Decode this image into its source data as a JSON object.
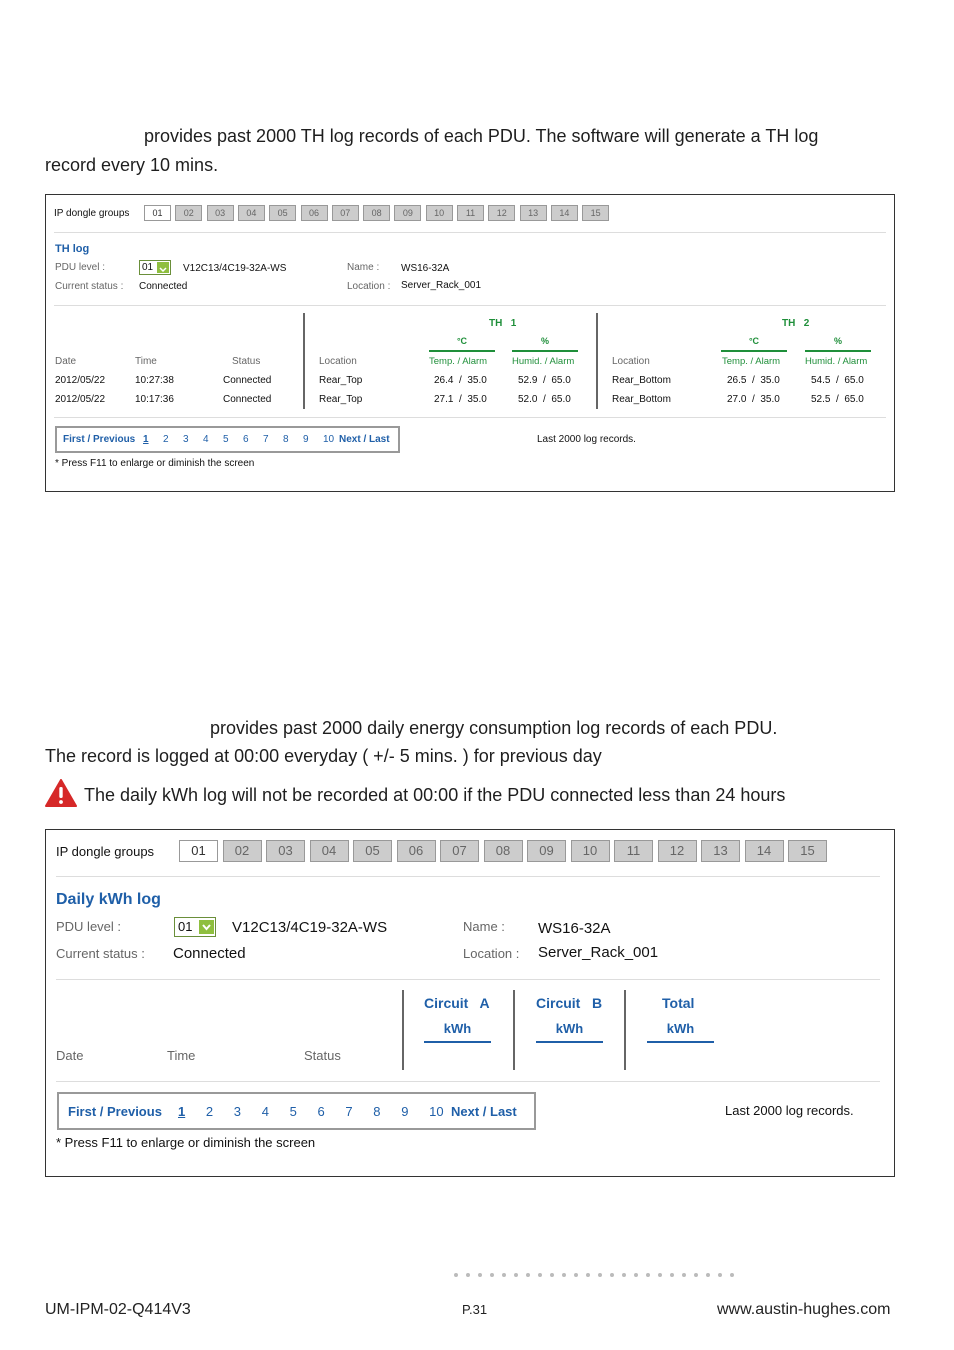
{
  "intro_th": {
    "line1": "provides past 2000 TH log records of each PDU.  The software will generate a TH log",
    "line2": "record every 10 mins."
  },
  "th_panel": {
    "group_label": "IP dongle groups",
    "groups": [
      "01",
      "02",
      "03",
      "04",
      "05",
      "06",
      "07",
      "08",
      "09",
      "10",
      "11",
      "12",
      "13",
      "14",
      "15"
    ],
    "title": "TH log",
    "pdu_level_label": "PDU level :",
    "pdu_level_value": "01",
    "pdu_model": "V12C13/4C19-32A-WS",
    "name_label": "Name :",
    "name_value": "WS16-32A",
    "status_label": "Current status :",
    "status_value": "Connected",
    "location_label": "Location :",
    "location_value": "Server_Rack_001",
    "th1_title": "TH",
    "th1_num": "1",
    "th2_title": "TH",
    "th2_num": "2",
    "unit_c": "°C",
    "unit_pct": "%",
    "col_date": "Date",
    "col_time": "Time",
    "col_status": "Status",
    "col_location": "Location",
    "col_temp": "Temp. / Alarm",
    "col_humid": "Humid. / Alarm",
    "rows": [
      {
        "date": "2012/05/22",
        "time": "10:27:38",
        "status": "Connected",
        "loc1": "Rear_Top",
        "t1": "26.4  /  35.0",
        "h1": "52.9  /  65.0",
        "loc2": "Rear_Bottom",
        "t2": "26.5  /  35.0",
        "h2": "54.5  /  65.0"
      },
      {
        "date": "2012/05/22",
        "time": "10:17:36",
        "status": "Connected",
        "loc1": "Rear_Top",
        "t1": "27.1  /  35.0",
        "h1": "52.0  /  65.0",
        "loc2": "Rear_Bottom",
        "t2": "27.0  /  35.0",
        "h2": "52.5  /  65.0"
      }
    ],
    "pager": {
      "first_prev": "First / Previous",
      "pages": [
        "1",
        "2",
        "3",
        "4",
        "5",
        "6",
        "7",
        "8",
        "9",
        "10"
      ],
      "next_last": "Next / Last"
    },
    "records_note": "Last 2000 log records.",
    "f11_note": "* Press F11 to enlarge or diminish the screen"
  },
  "intro_kwh": {
    "line1": "provides past 2000 daily energy consumption log records of each PDU.",
    "line2": "The record is logged at 00:00 everyday ( +/- 5 mins. ) for previous day",
    "warning": "The daily kWh log will not be recorded at 00:00 if the PDU connected less than 24 hours"
  },
  "kwh_panel": {
    "group_label": "IP dongle groups",
    "groups": [
      "01",
      "02",
      "03",
      "04",
      "05",
      "06",
      "07",
      "08",
      "09",
      "10",
      "11",
      "12",
      "13",
      "14",
      "15"
    ],
    "title": "Daily kWh log",
    "pdu_level_label": "PDU level :",
    "pdu_level_value": "01",
    "pdu_model": "V12C13/4C19-32A-WS",
    "name_label": "Name :",
    "name_value": "WS16-32A",
    "status_label": "Current status :",
    "status_value": "Connected",
    "location_label": "Location :",
    "location_value": "Server_Rack_001",
    "circuit_a": "Circuit   A",
    "circuit_b": "Circuit   B",
    "total": "Total",
    "unit": "kWh",
    "col_date": "Date",
    "col_time": "Time",
    "col_status": "Status",
    "pager": {
      "first_prev": "First / Previous",
      "pages": [
        "1",
        "2",
        "3",
        "4",
        "5",
        "6",
        "7",
        "8",
        "9",
        "10"
      ],
      "next_last": "Next / Last"
    },
    "records_note": "Last 2000 log records.",
    "f11_note": "* Press F11 to enlarge or diminish the screen"
  },
  "footer": {
    "doc_id": "UM-IPM-02-Q414V3",
    "page": "P.31",
    "website": "www.austin-hughes.com"
  },
  "colors": {
    "link_blue": "#1f5fa8",
    "underline_green": "#1f8f3a",
    "warning_red": "#d62828"
  }
}
